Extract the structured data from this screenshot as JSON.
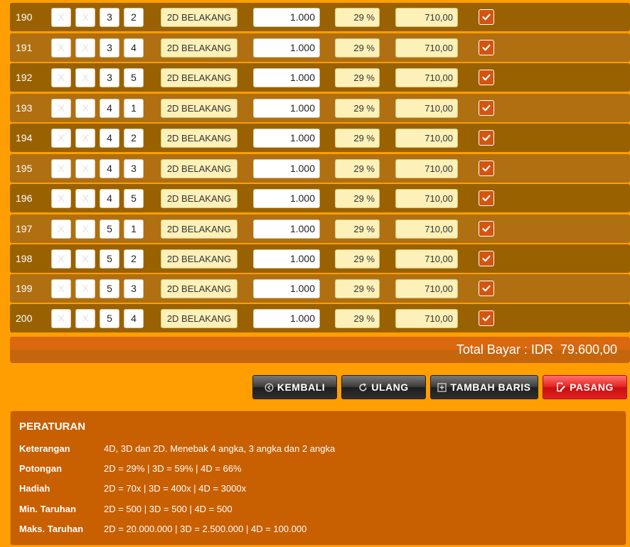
{
  "rows": [
    {
      "no": "190",
      "d1": "X",
      "d2": "X",
      "d3": "3",
      "d4": "2",
      "type": "2D BELAKANG",
      "amount": "1.000",
      "discount": "29 %",
      "pay": "710,00"
    },
    {
      "no": "191",
      "d1": "X",
      "d2": "X",
      "d3": "3",
      "d4": "4",
      "type": "2D BELAKANG",
      "amount": "1.000",
      "discount": "29 %",
      "pay": "710,00"
    },
    {
      "no": "192",
      "d1": "X",
      "d2": "X",
      "d3": "3",
      "d4": "5",
      "type": "2D BELAKANG",
      "amount": "1.000",
      "discount": "29 %",
      "pay": "710,00"
    },
    {
      "no": "193",
      "d1": "X",
      "d2": "X",
      "d3": "4",
      "d4": "1",
      "type": "2D BELAKANG",
      "amount": "1.000",
      "discount": "29 %",
      "pay": "710,00"
    },
    {
      "no": "194",
      "d1": "X",
      "d2": "X",
      "d3": "4",
      "d4": "2",
      "type": "2D BELAKANG",
      "amount": "1.000",
      "discount": "29 %",
      "pay": "710,00"
    },
    {
      "no": "195",
      "d1": "X",
      "d2": "X",
      "d3": "4",
      "d4": "3",
      "type": "2D BELAKANG",
      "amount": "1.000",
      "discount": "29 %",
      "pay": "710,00"
    },
    {
      "no": "196",
      "d1": "X",
      "d2": "X",
      "d3": "4",
      "d4": "5",
      "type": "2D BELAKANG",
      "amount": "1.000",
      "discount": "29 %",
      "pay": "710,00"
    },
    {
      "no": "197",
      "d1": "X",
      "d2": "X",
      "d3": "5",
      "d4": "1",
      "type": "2D BELAKANG",
      "amount": "1.000",
      "discount": "29 %",
      "pay": "710,00"
    },
    {
      "no": "198",
      "d1": "X",
      "d2": "X",
      "d3": "5",
      "d4": "2",
      "type": "2D BELAKANG",
      "amount": "1.000",
      "discount": "29 %",
      "pay": "710,00"
    },
    {
      "no": "199",
      "d1": "X",
      "d2": "X",
      "d3": "5",
      "d4": "3",
      "type": "2D BELAKANG",
      "amount": "1.000",
      "discount": "29 %",
      "pay": "710,00"
    },
    {
      "no": "200",
      "d1": "X",
      "d2": "X",
      "d3": "5",
      "d4": "4",
      "type": "2D BELAKANG",
      "amount": "1.000",
      "discount": "29 %",
      "pay": "710,00"
    }
  ],
  "checkbox_icon": "checkmark-icon",
  "total": {
    "label": "Total Bayar :",
    "value": "IDR  79.600,00"
  },
  "buttons": {
    "back": {
      "label": "KEMBALI",
      "icon": "circle-arrow-left-icon"
    },
    "reset": {
      "label": "ULANG",
      "icon": "refresh-icon"
    },
    "add_row": {
      "label": "TAMBAH BARIS",
      "icon": "plus-square-icon"
    },
    "submit": {
      "label": "PASANG",
      "icon": "edit-icon"
    }
  },
  "rules": {
    "title": "PERATURAN",
    "items": [
      {
        "label": "Keterangan",
        "value": "4D, 3D dan 2D. Menebak 4 angka, 3 angka dan 2 angka"
      },
      {
        "label": "Potongan",
        "value": "2D = 29% | 3D = 59% | 4D = 66%"
      },
      {
        "label": "Hadiah",
        "value": "2D = 70x | 3D = 400x | 4D = 3000x"
      },
      {
        "label": "Min. Taruhan",
        "value": "2D = 500 | 3D = 500 | 4D = 500"
      },
      {
        "label": "Maks. Taruhan",
        "value": "2D = 20.000.000 | 3D = 2.500.000 | 4D = 100.000"
      }
    ]
  },
  "colors": {
    "page_bg": "#FF9E00",
    "row_dark": "#9A6100",
    "row_light": "#B06F10",
    "rules_bg": "#C85F00",
    "checkbox": "#D3550F"
  }
}
